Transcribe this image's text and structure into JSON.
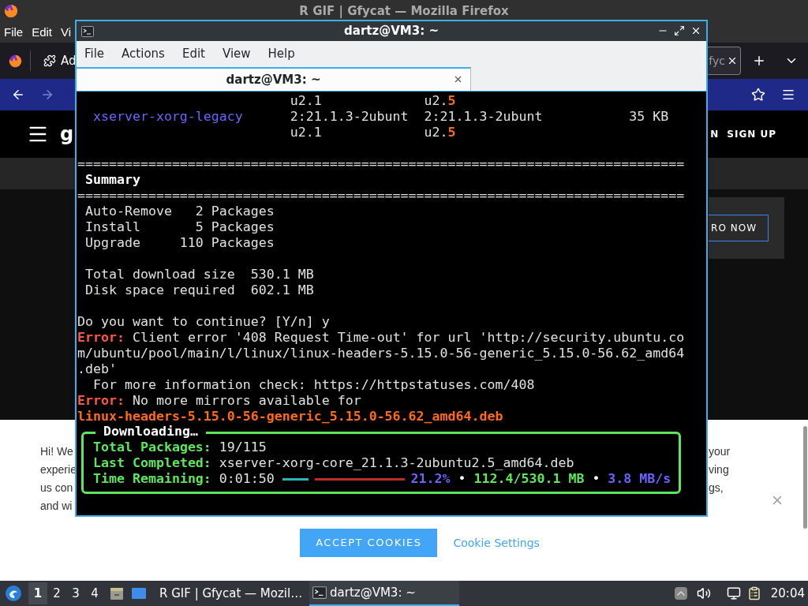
{
  "firefox": {
    "title": "R GIF | Gfycat — Mozilla Firefox",
    "menu": [
      "File",
      "Edit",
      "Vi"
    ],
    "tabs": [
      {
        "label": "Ad",
        "selected": false
      },
      {
        "label": "fyc",
        "selected": true
      }
    ],
    "page": {
      "logo": "g",
      "nav_links": [
        "N",
        "SIGN UP"
      ],
      "promo_button": "RO NOW",
      "cookie_banner": {
        "left_fragments": [
          "Hi! We",
          "experie",
          "us con",
          "and wi"
        ],
        "right_fragments": [
          "your",
          "ving",
          "gs,"
        ],
        "accept": "ACCEPT COOKIES",
        "settings": "Cookie Settings"
      }
    }
  },
  "terminal": {
    "title": "dartz@VM3: ~",
    "menu": [
      "File",
      "Actions",
      "Edit",
      "View",
      "Help"
    ],
    "tab": "dartz@VM3: ~",
    "package_rows": [
      {
        "old": "u2.1",
        "new": "u2.",
        "new_changed": "5"
      },
      {
        "name": "xserver-xorg-legacy",
        "old": "2:21.1.3-2ubunt",
        "new": "2:21.1.3-2ubunt",
        "size": "35 KB"
      },
      {
        "old": "u2.1",
        "new": "u2.",
        "new_changed": "5"
      }
    ],
    "separator": "=============================================================================",
    "summary_heading": "Summary",
    "counts": [
      {
        "label": "Auto-Remove",
        "value": "2",
        "unit": "Packages"
      },
      {
        "label": "Install",
        "value": "5",
        "unit": "Packages"
      },
      {
        "label": "Upgrade",
        "value": "110",
        "unit": "Packages"
      }
    ],
    "sizes": [
      {
        "label": "Total download size",
        "value": "530.1 MB"
      },
      {
        "label": "Disk space required",
        "value": "602.1 MB"
      }
    ],
    "log": [
      {
        "kind": "plain",
        "text": "Do you want to continue? [Y/n] y"
      },
      {
        "kind": "error",
        "label": "Error:",
        "text": "Client error '408 Request Time-out' for url 'http://security.ubuntu.com/ubuntu/pool/main/l/linux/linux-headers-5.15.0-56-generic_5.15.0-56.62_amd64.deb'"
      },
      {
        "kind": "note",
        "text": "For more information check: https://httpstatuses.com/408"
      },
      {
        "kind": "error",
        "label": "Error:",
        "text": "No more mirrors available for"
      },
      {
        "kind": "file",
        "text": "linux-headers-5.15.0-56-generic_5.15.0-56.62_amd64.deb"
      }
    ],
    "download": {
      "title": "Downloading…",
      "rows": [
        {
          "label": "Total Packages:",
          "value": "19/115"
        },
        {
          "label": "Last Completed:",
          "value": "xserver-xorg-core_21.1.3-2ubuntu2.5_amd64.deb"
        }
      ],
      "time_label": "Time Remaining:",
      "time_value": "0:01:50",
      "level": 0.212,
      "percent": "21.2%",
      "bullet": "•",
      "transferred": "112.4/530.1 MB",
      "speed": "3.8 MB/s"
    }
  },
  "taskbar": {
    "workspaces": [
      {
        "label": "1",
        "selected": true
      },
      {
        "label": "2",
        "selected": false
      },
      {
        "label": "3",
        "selected": false
      },
      {
        "label": "4",
        "selected": false
      }
    ],
    "tasks": [
      {
        "kind": "browser",
        "label": "R GIF | Gfycat — Mozil…",
        "selected": false
      },
      {
        "kind": "terminal",
        "label": "dartz@VM3: ~",
        "selected": true
      }
    ],
    "clock": "20:04"
  }
}
